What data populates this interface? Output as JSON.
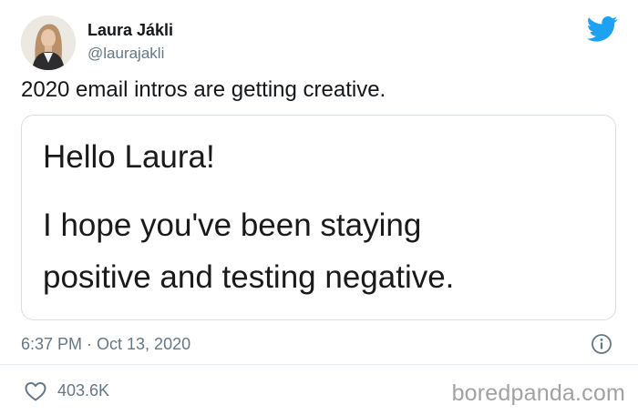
{
  "tweet": {
    "author_name": "Laura Jákli",
    "author_handle": "@laurajakli",
    "text": "2020 email intros are getting creative.",
    "timestamp": "6:37 PM · Oct 13, 2020",
    "like_count": "403.6K"
  },
  "email_screenshot": {
    "greeting": "Hello Laura!",
    "body_line1": "I hope you've been staying",
    "body_line2": "positive and testing negative."
  },
  "watermark": "boredpanda.com",
  "colors": {
    "twitter_blue": "#1da1f2",
    "secondary_text": "#657786",
    "border": "#d9dee2"
  },
  "icons": {
    "brand": "twitter-bird-icon",
    "info": "info-icon",
    "like": "heart-outline-icon"
  }
}
